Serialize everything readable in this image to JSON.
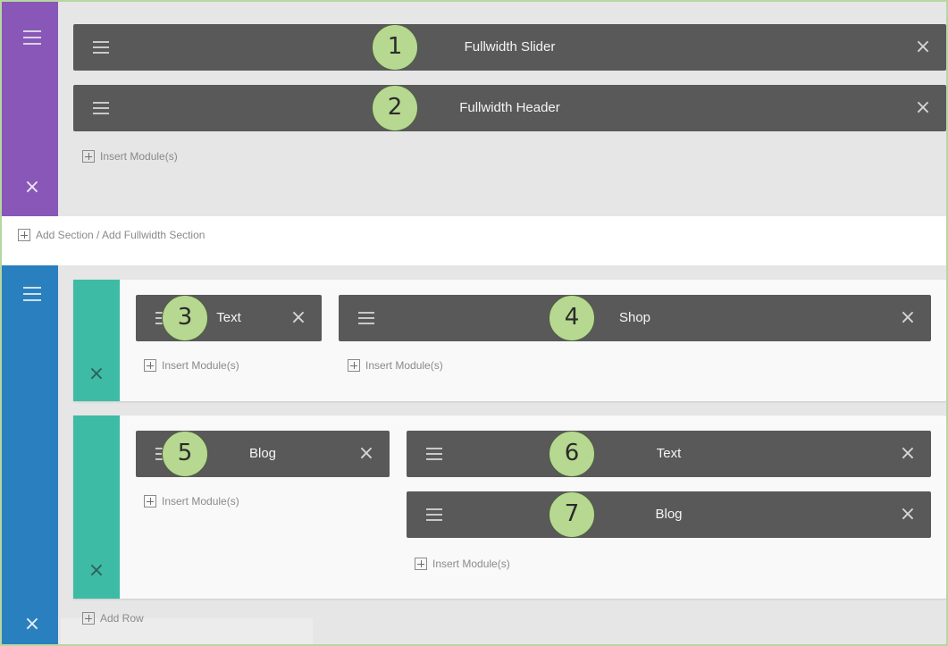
{
  "fullwidth_section": {
    "modules": [
      {
        "title": "Fullwidth Slider",
        "badge": "1"
      },
      {
        "title": "Fullwidth Header",
        "badge": "2"
      }
    ],
    "insert_label": "Insert Module(s)"
  },
  "add_section_label": "Add Section / Add Fullwidth Section",
  "section": {
    "rows": [
      {
        "columns": [
          {
            "modules": [
              {
                "title": "Text",
                "badge": "3"
              }
            ],
            "insert_label": "Insert Module(s)"
          },
          {
            "modules": [
              {
                "title": "Shop",
                "badge": "4"
              }
            ],
            "insert_label": "Insert Module(s)"
          }
        ]
      },
      {
        "columns": [
          {
            "modules": [
              {
                "title": "Blog",
                "badge": "5"
              }
            ],
            "insert_label": "Insert Module(s)"
          },
          {
            "modules": [
              {
                "title": "Text",
                "badge": "6"
              },
              {
                "title": "Blog",
                "badge": "7"
              }
            ],
            "insert_label": "Insert Module(s)"
          }
        ]
      }
    ],
    "add_row_label": "Add Row"
  },
  "icons": {
    "menu": "hamburger-icon",
    "close": "close-icon",
    "add": "plus-square-icon"
  },
  "colors": {
    "fullwidth_section_bar": "#8957b8",
    "section_bar": "#2a80be",
    "row_bar": "#3dbba5",
    "module_bg": "#595959",
    "badge_bg": "#b6d890"
  }
}
